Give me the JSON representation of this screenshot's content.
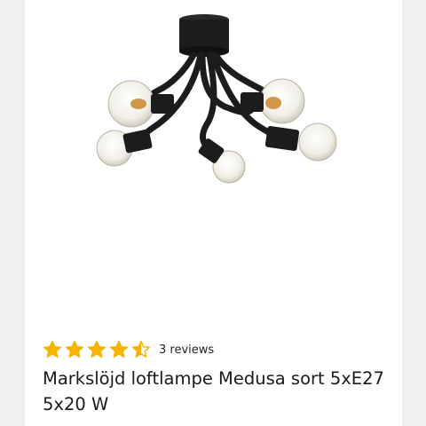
{
  "product": {
    "image_alt": "Ceiling lamp with five curved black arms and clear globe bulbs",
    "rating": 4.5,
    "rating_max": 5,
    "reviews_text": "3 reviews",
    "title": "Markslöjd loftlampe Medusa sort 5xE27 5x20 W"
  },
  "colors": {
    "star": "#f5b400",
    "lamp_body": "#1c1c1c",
    "bulb_glass": "#f4f2ea"
  }
}
